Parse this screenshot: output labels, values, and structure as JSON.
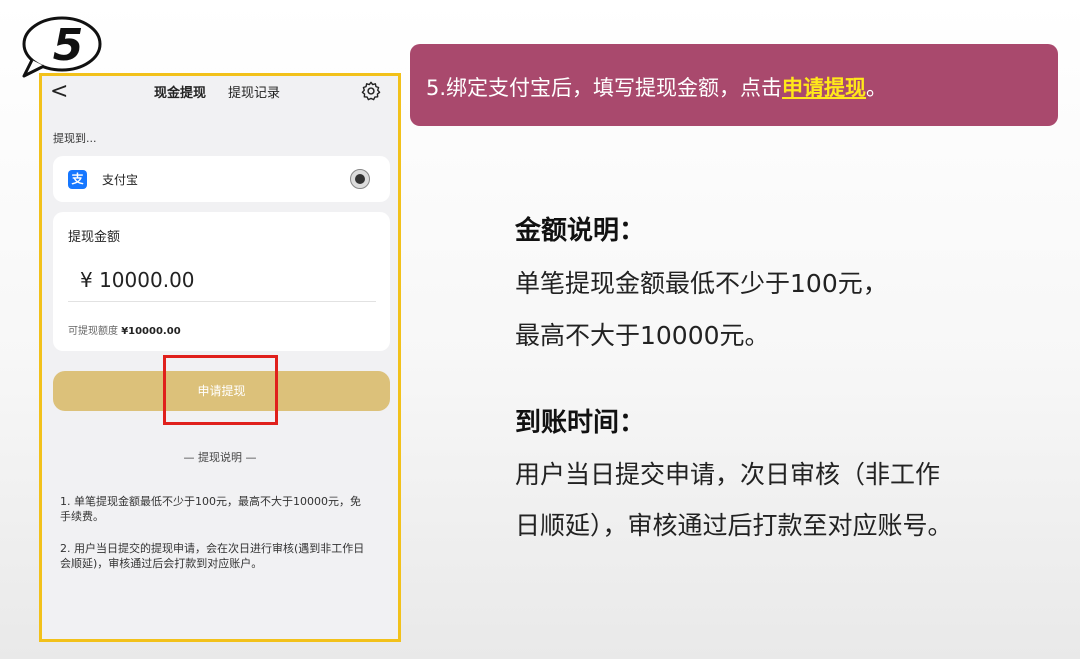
{
  "step_badge": "5",
  "phone": {
    "nav": {
      "back_glyph": "<",
      "tab_withdraw": "现金提现",
      "tab_records": "提现记录",
      "settings_icon": "gear-icon"
    },
    "withdraw_to_label": "提现到...",
    "payment_method": {
      "icon": "alipay-icon",
      "logo_char": "支",
      "name": "支付宝",
      "selected": true
    },
    "amount_card": {
      "label": "提现金额",
      "value": "¥ 10000.00",
      "available_label": "可提现额度",
      "available_value": "¥10000.00"
    },
    "apply_button": "申请提现",
    "explain_title": "—   提现说明   —",
    "notes": [
      "1. 单笔提现金额最低不少于100元，最高不大于10000元，免手续费。",
      "2. 用户当日提交的提现申请，会在次日进行审核(遇到非工作日会顺延)，审核通过后会打款到对应账户。"
    ],
    "frame_color": "#f2c11a",
    "highlight_color": "#e0201c"
  },
  "callout": {
    "text_prefix": "5.绑定支付宝后，填写提现金额，点击",
    "text_highlight": "申请提现",
    "text_suffix": "。",
    "bg_color": "#a9496d",
    "highlight_color": "#ffe81a"
  },
  "amount_section": {
    "title": "金额说明：",
    "lines": [
      "单笔提现金额最低不少于100元，",
      "最高不大于10000元。"
    ]
  },
  "arrival_section": {
    "title": "到账时间：",
    "lines": [
      "用户当日提交申请，次日审核（非工作",
      "日顺延），审核通过后打款至对应账号。"
    ]
  }
}
